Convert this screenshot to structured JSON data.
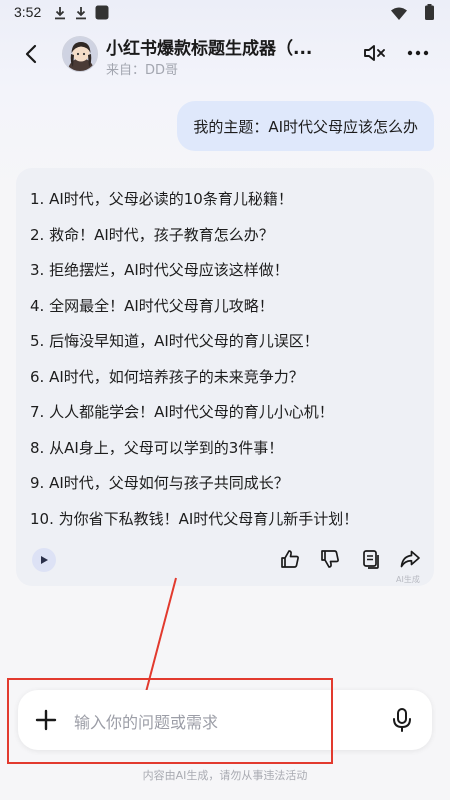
{
  "status_bar": {
    "time": "3:52",
    "icons": [
      "download-icon",
      "download-icon",
      "app-icon",
      "wifi-icon",
      "battery-icon"
    ]
  },
  "header": {
    "title": "小红书爆款标题生成器（...",
    "source": "来自：DD哥",
    "icons": [
      "back-icon",
      "mute-icon",
      "more-icon"
    ]
  },
  "user_message": "我的主题：AI时代父母应该怎么办",
  "answer": {
    "items": [
      "1. AI时代，父母必读的10条育儿秘籍！",
      "2. 救命！AI时代，孩子教育怎么办？",
      "3. 拒绝摆烂，AI时代父母应该这样做！",
      "4. 全网最全！AI时代父母育儿攻略！",
      "5. 后悔没早知道，AI时代父母的育儿误区！",
      "6. AI时代，如何培养孩子的未来竞争力？",
      "7. 人人都能学会！AI时代父母的育儿小心机！",
      "8. 从AI身上，父母可以学到的3件事！",
      "9. AI时代，父母如何与孩子共同成长？",
      "10. 为你省下私教钱！AI时代父母育儿新手计划！"
    ],
    "ai_tag": "AI生成",
    "actions": [
      "play-icon",
      "thumbs-up-icon",
      "thumbs-down-icon",
      "copy-icon",
      "share-icon"
    ]
  },
  "input": {
    "placeholder": "输入你的问题或需求"
  },
  "disclaimer": "内容由AI生成，请勿从事违法活动",
  "colors": {
    "user_bubble": "#dfe8fb",
    "answer_card": "#eef0f5",
    "annotation": "#e23a2e"
  }
}
